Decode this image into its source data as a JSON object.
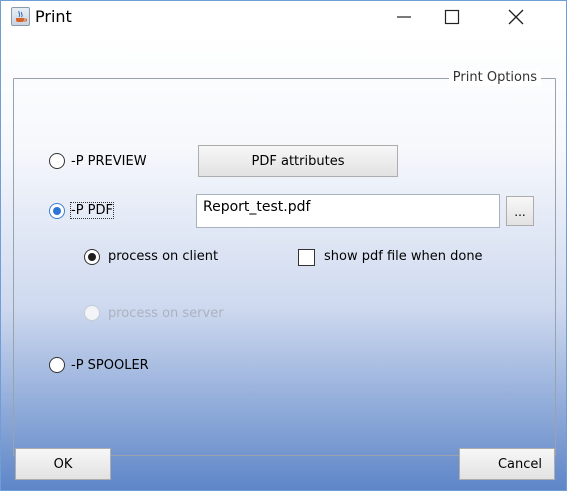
{
  "window": {
    "title": "Print",
    "icon": "java-cup-icon",
    "controls": {
      "minimize": "minimize-icon",
      "maximize": "maximize-icon",
      "close": "close-icon"
    }
  },
  "options_group": {
    "legend": "Print Options",
    "preview": {
      "label": "-P PREVIEW",
      "selected": false,
      "attributes_button": "PDF attributes"
    },
    "pdf": {
      "label": "-P PDF",
      "selected": true,
      "filename": "Report_test.pdf",
      "browse_button": "..."
    },
    "process_client": {
      "label": "process on client",
      "selected": true
    },
    "show_pdf": {
      "label": "show pdf file when done",
      "checked": false
    },
    "process_server": {
      "label": "process on server",
      "selected": false,
      "enabled": false
    },
    "spooler": {
      "label": "-P SPOOLER",
      "selected": false
    }
  },
  "footer": {
    "ok_label": "OK",
    "cancel_label": "Cancel"
  },
  "colors": {
    "accent": "#2d74d9",
    "gradient_bottom": "#5e86c8"
  }
}
